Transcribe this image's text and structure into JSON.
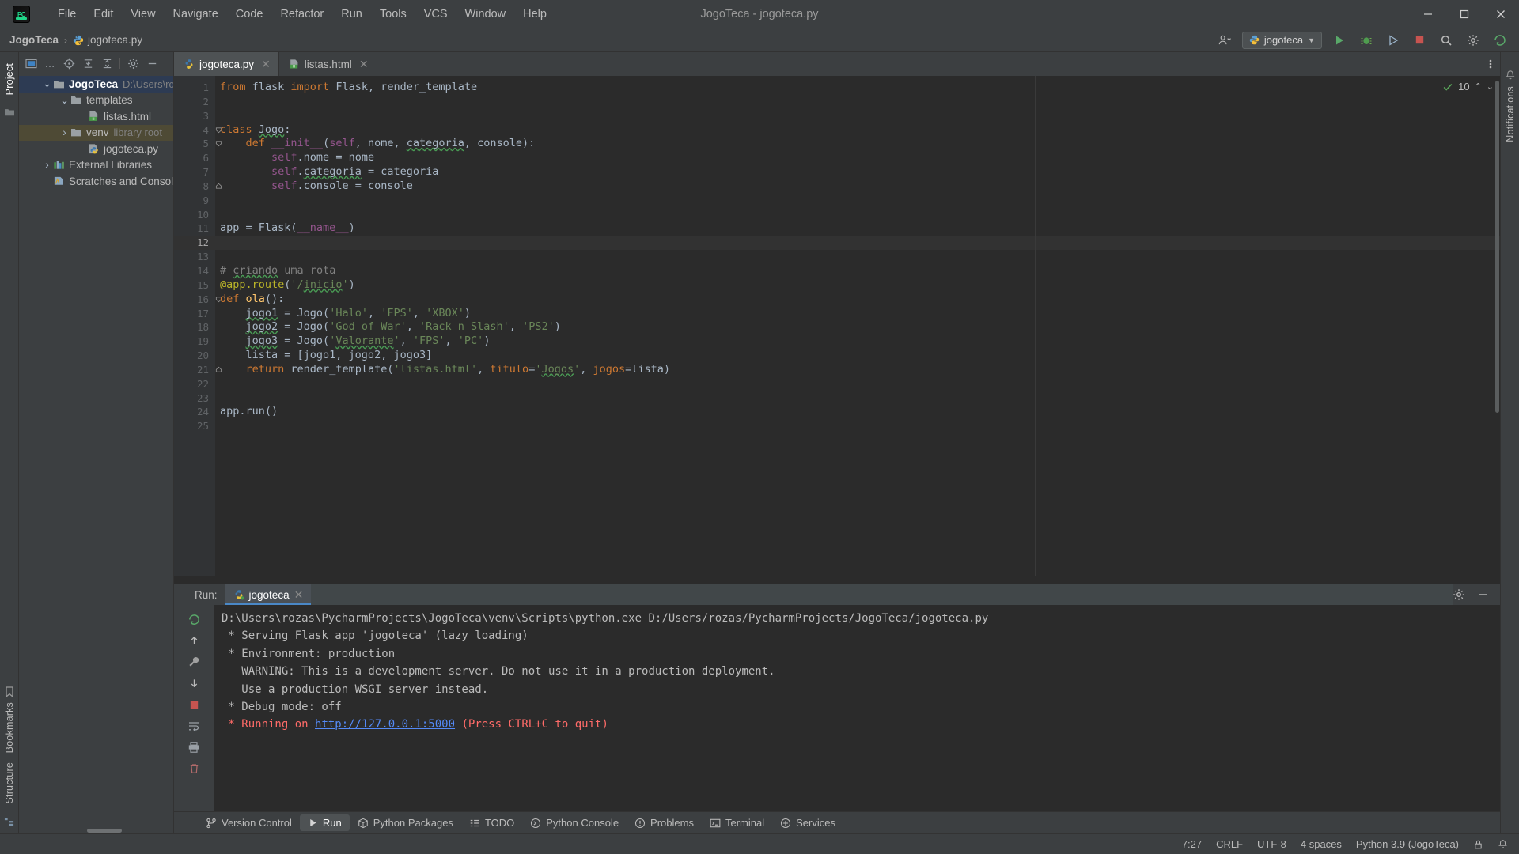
{
  "window": {
    "title": "JogoTeca - jogoteca.py",
    "controls": {
      "minimize": "—",
      "maximize": "❐",
      "close": "✕"
    }
  },
  "menu": {
    "items": [
      "File",
      "Edit",
      "View",
      "Navigate",
      "Code",
      "Refactor",
      "Run",
      "Tools",
      "VCS",
      "Window",
      "Help"
    ]
  },
  "navbar": {
    "project": "JogoTeca",
    "separator": "›",
    "file": "jogoteca.py",
    "run_config": "jogoteca",
    "icons": [
      "account-icon",
      "run-config-dropdown",
      "run-icon",
      "debug-icon",
      "coverage-icon",
      "stop-icon",
      "search-icon",
      "settings-icon",
      "updates-icon"
    ]
  },
  "left_strip": {
    "top_tab": "Project",
    "bottom_tabs": [
      "Bookmarks",
      "Structure"
    ]
  },
  "project_panel": {
    "toolbar_icons": [
      "project-scope-icon",
      "ellipsis-icon",
      "locate-icon",
      "expand-all-icon",
      "collapse-all-icon",
      "settings-icon",
      "hide-icon"
    ],
    "tree": [
      {
        "label": "JogoTeca",
        "sub": "D:\\Users\\rozas\\P",
        "depth": 0,
        "twisty": "⌄",
        "icon": "folder-icon",
        "bold": true,
        "selected": "blue"
      },
      {
        "label": "templates",
        "sub": "",
        "depth": 1,
        "twisty": "⌄",
        "icon": "folder-icon",
        "bold": false,
        "selected": ""
      },
      {
        "label": "listas.html",
        "sub": "",
        "depth": 2,
        "twisty": "",
        "icon": "html-file-icon",
        "bold": false,
        "selected": ""
      },
      {
        "label": "venv",
        "sub": "library root",
        "depth": 1,
        "twisty": "›",
        "icon": "folder-icon",
        "bold": false,
        "selected": "olive"
      },
      {
        "label": "jogoteca.py",
        "sub": "",
        "depth": 2,
        "twisty": "",
        "icon": "python-file-icon",
        "bold": false,
        "selected": ""
      },
      {
        "label": "External Libraries",
        "sub": "",
        "depth": 0,
        "twisty": "›",
        "icon": "libraries-icon",
        "bold": false,
        "selected": ""
      },
      {
        "label": "Scratches and Consoles",
        "sub": "",
        "depth": 0,
        "twisty": "",
        "icon": "scratches-icon",
        "bold": false,
        "selected": ""
      }
    ]
  },
  "editor": {
    "tabs": [
      {
        "label": "jogoteca.py",
        "icon": "python-file-icon",
        "active": true,
        "close": "✕"
      },
      {
        "label": "listas.html",
        "icon": "html-file-icon",
        "active": false,
        "close": "✕"
      }
    ],
    "inspection": {
      "ok_icon": "check-icon",
      "count": "10",
      "chevron_up": "⌃",
      "chevron_down": "⌄"
    },
    "line_count": 25,
    "current_line": 12,
    "lines": [
      {
        "n": 1,
        "tokens": [
          {
            "t": "from ",
            "c": "kw"
          },
          {
            "t": "flask ",
            "c": "cls"
          },
          {
            "t": "import ",
            "c": "kw"
          },
          {
            "t": "Flask, render_template",
            "c": "cls"
          }
        ]
      },
      {
        "n": 2,
        "tokens": []
      },
      {
        "n": 3,
        "tokens": []
      },
      {
        "n": 4,
        "tokens": [
          {
            "t": "class ",
            "c": "kw"
          },
          {
            "t": "Jogo",
            "c": "cls sq"
          },
          {
            "t": ":",
            "c": "punc"
          }
        ]
      },
      {
        "n": 5,
        "tokens": [
          {
            "t": "    ",
            "c": "punc"
          },
          {
            "t": "def ",
            "c": "kw"
          },
          {
            "t": "__init__",
            "c": "self"
          },
          {
            "t": "(",
            "c": "punc"
          },
          {
            "t": "self",
            "c": "self"
          },
          {
            "t": ", nome, ",
            "c": "param"
          },
          {
            "t": "categoria",
            "c": "param sq"
          },
          {
            "t": ", console):",
            "c": "param"
          }
        ]
      },
      {
        "n": 6,
        "tokens": [
          {
            "t": "        ",
            "c": "punc"
          },
          {
            "t": "self",
            "c": "self"
          },
          {
            "t": ".nome = nome",
            "c": "cls"
          }
        ]
      },
      {
        "n": 7,
        "tokens": [
          {
            "t": "        ",
            "c": "punc"
          },
          {
            "t": "self",
            "c": "self"
          },
          {
            "t": ".",
            "c": "cls"
          },
          {
            "t": "categoria",
            "c": "cls sq"
          },
          {
            "t": " = categoria",
            "c": "cls"
          }
        ]
      },
      {
        "n": 8,
        "tokens": [
          {
            "t": "        ",
            "c": "punc"
          },
          {
            "t": "self",
            "c": "self"
          },
          {
            "t": ".console = console",
            "c": "cls"
          }
        ]
      },
      {
        "n": 9,
        "tokens": []
      },
      {
        "n": 10,
        "tokens": []
      },
      {
        "n": 11,
        "tokens": [
          {
            "t": "app = Flask(",
            "c": "cls"
          },
          {
            "t": "__name__",
            "c": "self"
          },
          {
            "t": ")",
            "c": "punc"
          }
        ]
      },
      {
        "n": 12,
        "tokens": []
      },
      {
        "n": 13,
        "tokens": []
      },
      {
        "n": 14,
        "tokens": [
          {
            "t": "# ",
            "c": "com"
          },
          {
            "t": "criando",
            "c": "com sq"
          },
          {
            "t": " uma rota",
            "c": "com"
          }
        ]
      },
      {
        "n": 15,
        "tokens": [
          {
            "t": "@app.route",
            "c": "deco"
          },
          {
            "t": "(",
            "c": "punc"
          },
          {
            "t": "'/",
            "c": "str"
          },
          {
            "t": "inicio",
            "c": "str sq"
          },
          {
            "t": "'",
            "c": "str"
          },
          {
            "t": ")",
            "c": "punc"
          }
        ]
      },
      {
        "n": 16,
        "tokens": [
          {
            "t": "def ",
            "c": "kw"
          },
          {
            "t": "ola",
            "c": "fn"
          },
          {
            "t": "():",
            "c": "punc"
          }
        ]
      },
      {
        "n": 17,
        "tokens": [
          {
            "t": "    ",
            "c": "punc"
          },
          {
            "t": "jogo1",
            "c": "cls sq"
          },
          {
            "t": " = Jogo(",
            "c": "cls"
          },
          {
            "t": "'Halo'",
            "c": "str"
          },
          {
            "t": ", ",
            "c": "punc"
          },
          {
            "t": "'FPS'",
            "c": "str"
          },
          {
            "t": ", ",
            "c": "punc"
          },
          {
            "t": "'XBOX'",
            "c": "str"
          },
          {
            "t": ")",
            "c": "punc"
          }
        ]
      },
      {
        "n": 18,
        "tokens": [
          {
            "t": "    ",
            "c": "punc"
          },
          {
            "t": "jogo2",
            "c": "cls sq"
          },
          {
            "t": " = Jogo(",
            "c": "cls"
          },
          {
            "t": "'God of War'",
            "c": "str"
          },
          {
            "t": ", ",
            "c": "punc"
          },
          {
            "t": "'Rack n Slash'",
            "c": "str"
          },
          {
            "t": ", ",
            "c": "punc"
          },
          {
            "t": "'PS2'",
            "c": "str"
          },
          {
            "t": ")",
            "c": "punc"
          }
        ]
      },
      {
        "n": 19,
        "tokens": [
          {
            "t": "    ",
            "c": "punc"
          },
          {
            "t": "jogo3",
            "c": "cls sq"
          },
          {
            "t": " = Jogo(",
            "c": "cls"
          },
          {
            "t": "'",
            "c": "str"
          },
          {
            "t": "Valorante",
            "c": "str sq"
          },
          {
            "t": "'",
            "c": "str"
          },
          {
            "t": ", ",
            "c": "punc"
          },
          {
            "t": "'FPS'",
            "c": "str"
          },
          {
            "t": ", ",
            "c": "punc"
          },
          {
            "t": "'PC'",
            "c": "str"
          },
          {
            "t": ")",
            "c": "punc"
          }
        ]
      },
      {
        "n": 20,
        "tokens": [
          {
            "t": "    lista = [jogo1, jogo2, jogo3]",
            "c": "cls"
          }
        ]
      },
      {
        "n": 21,
        "tokens": [
          {
            "t": "    ",
            "c": "punc"
          },
          {
            "t": "return ",
            "c": "kw"
          },
          {
            "t": "render_template(",
            "c": "cls"
          },
          {
            "t": "'listas.html'",
            "c": "str"
          },
          {
            "t": ", ",
            "c": "punc"
          },
          {
            "t": "titulo",
            "c": "kwarg"
          },
          {
            "t": "=",
            "c": "punc"
          },
          {
            "t": "'",
            "c": "str"
          },
          {
            "t": "Jogos",
            "c": "str sq"
          },
          {
            "t": "'",
            "c": "str"
          },
          {
            "t": ", ",
            "c": "punc"
          },
          {
            "t": "jogos",
            "c": "kwarg"
          },
          {
            "t": "=lista)",
            "c": "cls"
          }
        ]
      },
      {
        "n": 22,
        "tokens": []
      },
      {
        "n": 23,
        "tokens": []
      },
      {
        "n": 24,
        "tokens": [
          {
            "t": "app.run()",
            "c": "cls"
          }
        ]
      },
      {
        "n": 25,
        "tokens": []
      }
    ]
  },
  "run_panel": {
    "label": "Run:",
    "tab": "jogoteca",
    "tab_close": "✕",
    "gutter_icons": [
      "rerun-icon",
      "scroll-up-icon",
      "wrench-icon",
      "scroll-down-icon",
      "stop-icon",
      "soft-wrap-icon",
      "print-icon",
      "trash-icon"
    ],
    "header_icons": [
      "settings-icon",
      "hide-icon"
    ],
    "console": [
      {
        "text": "D:\\Users\\rozas\\PycharmProjects\\JogoTeca\\venv\\Scripts\\python.exe D:/Users/rozas/PycharmProjects/JogoTeca/jogoteca.py",
        "color": "white"
      },
      {
        "text": " * Serving Flask app 'jogoteca' (lazy loading)",
        "color": "white"
      },
      {
        "text": " * Environment: production",
        "color": "white"
      },
      {
        "text": "   WARNING: This is a development server. Do not use it in a production deployment.",
        "color": "white"
      },
      {
        "text": "   Use a production WSGI server instead.",
        "color": "white"
      },
      {
        "text": " * Debug mode: off",
        "color": "white"
      },
      {
        "text": " * Running on ",
        "link": "http://127.0.0.1:5000",
        "suffix": " (Press CTRL+C to quit)",
        "color": "red"
      }
    ]
  },
  "bottom_bar": {
    "items": [
      {
        "label": "Version Control",
        "icon": "branch-icon",
        "selected": false
      },
      {
        "label": "Run",
        "icon": "play-icon",
        "selected": true
      },
      {
        "label": "Python Packages",
        "icon": "package-icon",
        "selected": false
      },
      {
        "label": "TODO",
        "icon": "todo-icon",
        "selected": false
      },
      {
        "label": "Python Console",
        "icon": "console-icon",
        "selected": false
      },
      {
        "label": "Problems",
        "icon": "problems-icon",
        "selected": false
      },
      {
        "label": "Terminal",
        "icon": "terminal-icon",
        "selected": false
      },
      {
        "label": "Services",
        "icon": "services-icon",
        "selected": false
      }
    ]
  },
  "status_bar": {
    "caret": "7:27",
    "line_separator": "CRLF",
    "encoding": "UTF-8",
    "indent": "4 spaces",
    "interpreter": "Python 3.9 (JogoTeca)",
    "icons": [
      "lock-icon",
      "notifications-icon"
    ]
  },
  "right_strip": {
    "tabs": [
      "Notifications"
    ]
  },
  "colors": {
    "bg_chrome": "#3c3f41",
    "bg_editor": "#2b2b2b",
    "gutter": "#313335",
    "accent_blue": "#4a88c7",
    "selection_blue": "#2d3b53",
    "selection_olive": "#4e4a35",
    "keyword_orange": "#cc7832",
    "string_green": "#6a8759",
    "self_purple": "#94558d",
    "decorator_yellow": "#bbb529",
    "function_yellow": "#ffc66d",
    "comment_gray": "#808080",
    "console_red": "#ff6b68",
    "link_blue": "#548af7",
    "text": "#bbbbbb"
  }
}
